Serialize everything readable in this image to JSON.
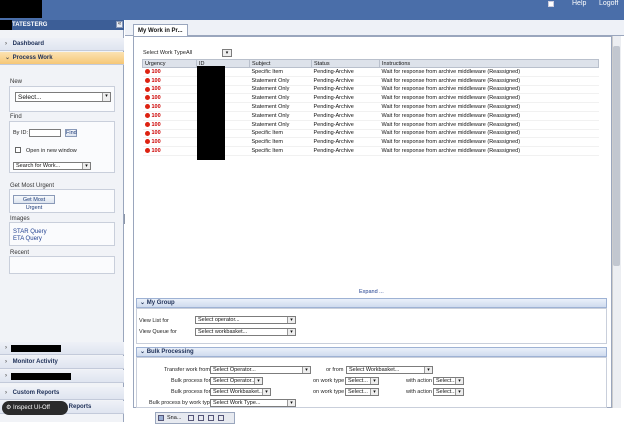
{
  "topbar": {
    "help_label": "Help",
    "logoff_label": "Logoff"
  },
  "left_panel": {
    "header_title": "TATESTERG",
    "collapse_glyph": "«",
    "accordion_top": [
      {
        "label": "Dashboard",
        "open": false
      },
      {
        "label": "Process Work",
        "open": true
      }
    ],
    "new_section": {
      "label": "New",
      "select_value": "Select..."
    },
    "find_section": {
      "label": "Find",
      "by_id_label": "By ID:",
      "find_button": "Find",
      "open_new_window_label": "Open in new window",
      "search_select": "Search for Work..."
    },
    "most_urgent": {
      "label": "Get Most Urgent",
      "button": "Get Most Urgent"
    },
    "images": {
      "label": "Images",
      "links": [
        "STAR Query",
        "ETA Query"
      ]
    },
    "recent": {
      "label": "Recent"
    },
    "accordion_bottom": [
      {
        "label": "Monitor Activity"
      },
      {
        "label": "Custom Reports"
      },
      {
        "label": "Reports"
      }
    ]
  },
  "main": {
    "tab_label": "My Work in Pr...",
    "work_type": {
      "label": "Select Work Type",
      "value": "All"
    },
    "table": {
      "columns": [
        "Urgency",
        "ID",
        "Subject",
        "Status",
        "Instructions"
      ],
      "rows": [
        {
          "urgency": "100",
          "subject": "Specific Item",
          "status": "Pending-Archive",
          "instructions": "Wait for response from archive middleware (Reassigned)"
        },
        {
          "urgency": "100",
          "subject": "Statement Only",
          "status": "Pending-Archive",
          "instructions": "Wait for response from archive middleware (Reassigned)"
        },
        {
          "urgency": "100",
          "subject": "Statement Only",
          "status": "Pending-Archive",
          "instructions": "Wait for response from archive middleware (Reassigned)"
        },
        {
          "urgency": "100",
          "subject": "Statement Only",
          "status": "Pending-Archive",
          "instructions": "Wait for response from archive middleware (Reassigned)"
        },
        {
          "urgency": "100",
          "subject": "Statement Only",
          "status": "Pending-Archive",
          "instructions": "Wait for response from archive middleware (Reassigned)"
        },
        {
          "urgency": "100",
          "subject": "Statement Only",
          "status": "Pending-Archive",
          "instructions": "Wait for response from archive middleware (Reassigned)"
        },
        {
          "urgency": "100",
          "subject": "Statement Only",
          "status": "Pending-Archive",
          "instructions": "Wait for response from archive middleware (Reassigned)"
        },
        {
          "urgency": "100",
          "subject": "Specific Item",
          "status": "Pending-Archive",
          "instructions": "Wait for response from archive middleware (Reassigned)"
        },
        {
          "urgency": "100",
          "subject": "Specific Item",
          "status": "Pending-Archive",
          "instructions": "Wait for response from archive middleware (Reassigned)"
        },
        {
          "urgency": "100",
          "subject": "Specific Item",
          "status": "Pending-Archive",
          "instructions": "Wait for response from archive middleware (Reassigned)"
        }
      ]
    },
    "expand_label": "Expand ...",
    "my_group": {
      "title": "My Group",
      "view_list_label": "View List for",
      "view_list_select": "Select operator...",
      "view_queue_label": "View Queue for",
      "view_queue_select": "Select workbasket..."
    },
    "bulk": {
      "title": "Bulk Processing",
      "transfer_label": "Transfer work from",
      "transfer_select": "Select Operator...",
      "or_from_label": "or from",
      "or_from_select": "Select Workbasket...",
      "bulk_for_label": "Bulk process for",
      "bulk_for_op_select": "Select Operator...",
      "bulk_for_wb_select": "Select Workbasket...",
      "on_work_type_label": "on work type",
      "select_short": "Select...",
      "with_action_label": "with action",
      "select_short2": "Select...",
      "bulk_by_type_label": "Bulk process by work type",
      "bulk_by_type_select": "Select Work Type..."
    }
  },
  "bottom": {
    "tab_label": "Sna...",
    "inspect_label": "Inspect UI-Off"
  },
  "colors": {
    "header_blue": "#4a6ea9",
    "urgency_red": "#cc0000",
    "accent_orange": "#f6c777"
  }
}
